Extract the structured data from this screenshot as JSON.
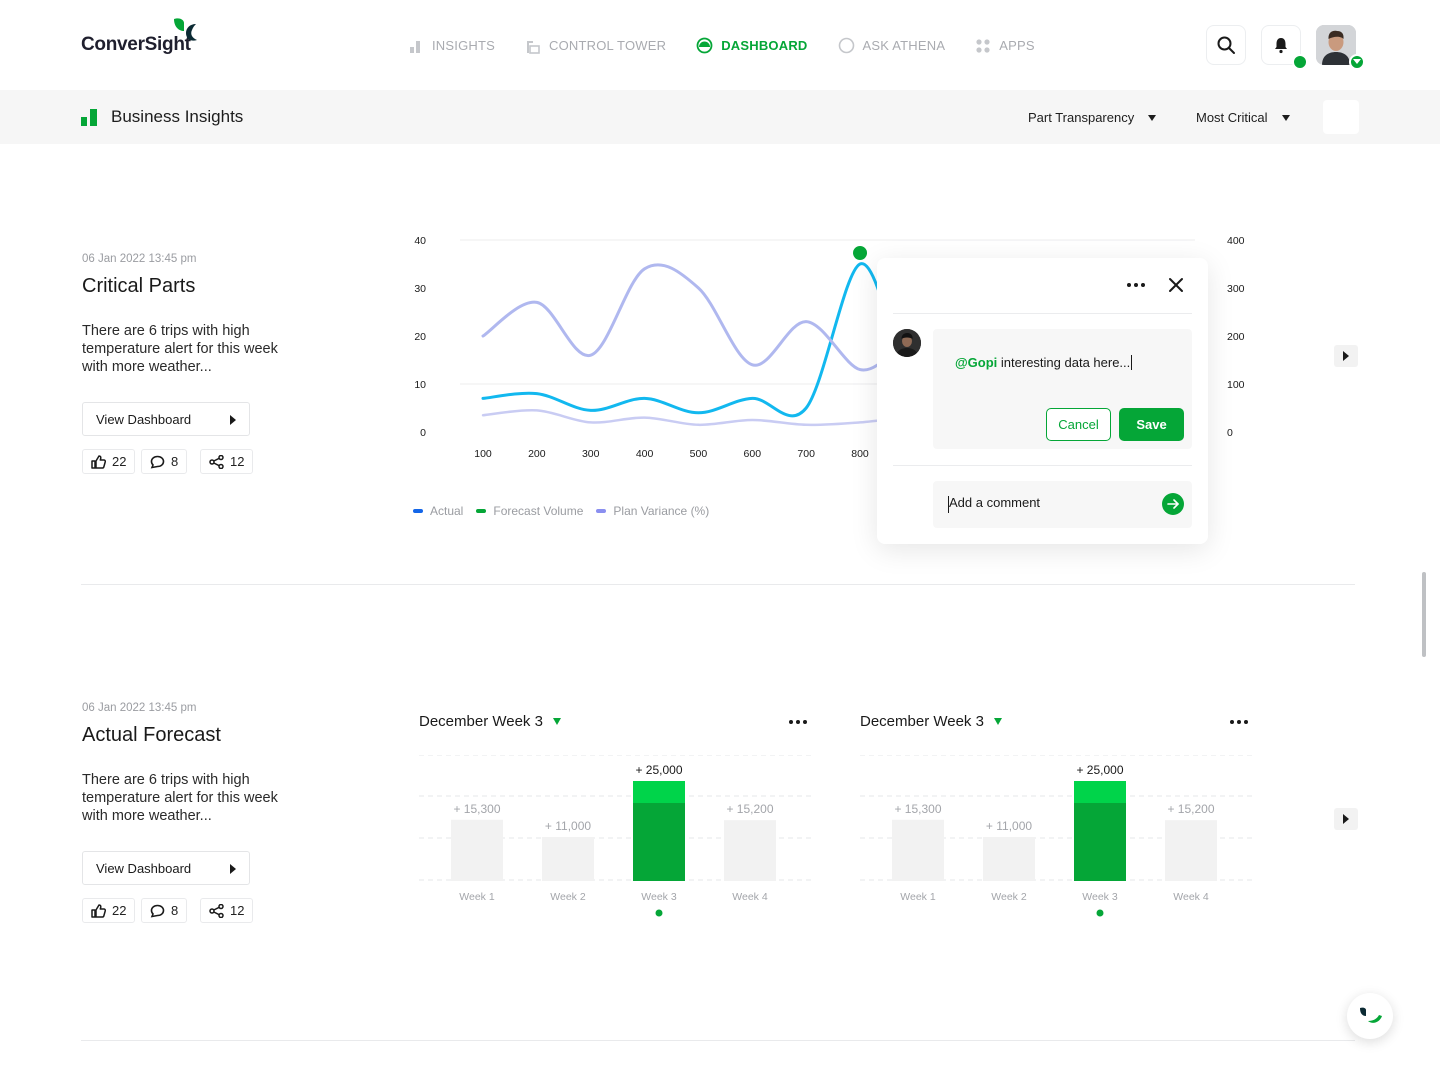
{
  "app": {
    "name": "ConverSight"
  },
  "nav": [
    {
      "label": "INSIGHTS",
      "icon": "bar-chart-icon",
      "active": false
    },
    {
      "label": "CONTROL TOWER",
      "icon": "tower-icon",
      "active": false
    },
    {
      "label": "DASHBOARD",
      "icon": "dashboard-gauge-icon",
      "active": true
    },
    {
      "label": "ASK ATHENA",
      "icon": "circle-icon",
      "active": false
    },
    {
      "label": "APPS",
      "icon": "apps-grid-icon",
      "active": false
    }
  ],
  "subheader": {
    "title": "Business Insights",
    "filter1": "Part Transparency",
    "filter2": "Most Critical"
  },
  "insights": [
    {
      "timestamp": "06 Jan 2022 13:45 pm",
      "title": "Critical Parts",
      "description": "There are 6 trips with high temperature alert for this week with more weather...",
      "view_label": "View Dashboard",
      "likes": "22",
      "comments": "8",
      "shares": "12"
    },
    {
      "timestamp": "06 Jan 2022 13:45 pm",
      "title": "Actual Forecast",
      "description": "There are 6 trips with high temperature alert for this week with more weather...",
      "view_label": "View Dashboard",
      "likes": "22",
      "comments": "8",
      "shares": "12"
    }
  ],
  "popup": {
    "mention": "@Gopi",
    "comment": " interesting data here...",
    "cancel_label": "Cancel",
    "save_label": "Save",
    "add_placeholder": "Add a comment"
  },
  "bar_panels": [
    {
      "title": "December Week 3"
    },
    {
      "title": "December Week 3"
    }
  ],
  "colors": {
    "brand": "#05a637",
    "actual": "#12b8ef",
    "plan": "#b0b8ef",
    "plan_legend": "#8a8ff0"
  },
  "chart_data": [
    {
      "type": "line",
      "x": [
        100,
        200,
        300,
        400,
        500,
        600,
        700,
        800
      ],
      "ylim_left": [
        0,
        40
      ],
      "ylim_right": [
        0,
        400
      ],
      "yticks_left": [
        0,
        10,
        20,
        30,
        40
      ],
      "yticks_right": [
        0,
        100,
        200,
        300,
        400
      ],
      "legend": [
        "Actual",
        "Forecast Volume",
        "Plan Variance (%)"
      ],
      "series": [
        {
          "name": "Actual",
          "values": [
            7,
            8,
            4.5,
            7,
            4,
            7,
            5,
            35
          ]
        },
        {
          "name": "Plan Variance (%)",
          "values": [
            20,
            27,
            16,
            34,
            30,
            14,
            23,
            13
          ]
        },
        {
          "name": "Forecast Volume",
          "values": [
            3.5,
            4.5,
            2,
            3,
            1.5,
            2.5,
            1.5,
            2
          ]
        }
      ],
      "highlight": {
        "x": 800,
        "y": 35
      }
    },
    {
      "type": "bar",
      "categories": [
        "Week 1",
        "Week 2",
        "Week 3",
        "Week 4"
      ],
      "values": [
        15300,
        11000,
        25000,
        15200
      ],
      "labels": [
        "+ 15,300",
        "+ 11,000",
        "+ 25,000",
        "+ 15,200"
      ],
      "highlight_index": 2,
      "ylim": [
        0,
        30000
      ]
    },
    {
      "type": "bar",
      "categories": [
        "Week 1",
        "Week 2",
        "Week 3",
        "Week 4"
      ],
      "values": [
        15300,
        11000,
        25000,
        15200
      ],
      "labels": [
        "+ 15,300",
        "+ 11,000",
        "+ 25,000",
        "+ 15,200"
      ],
      "highlight_index": 2,
      "ylim": [
        0,
        30000
      ]
    }
  ]
}
